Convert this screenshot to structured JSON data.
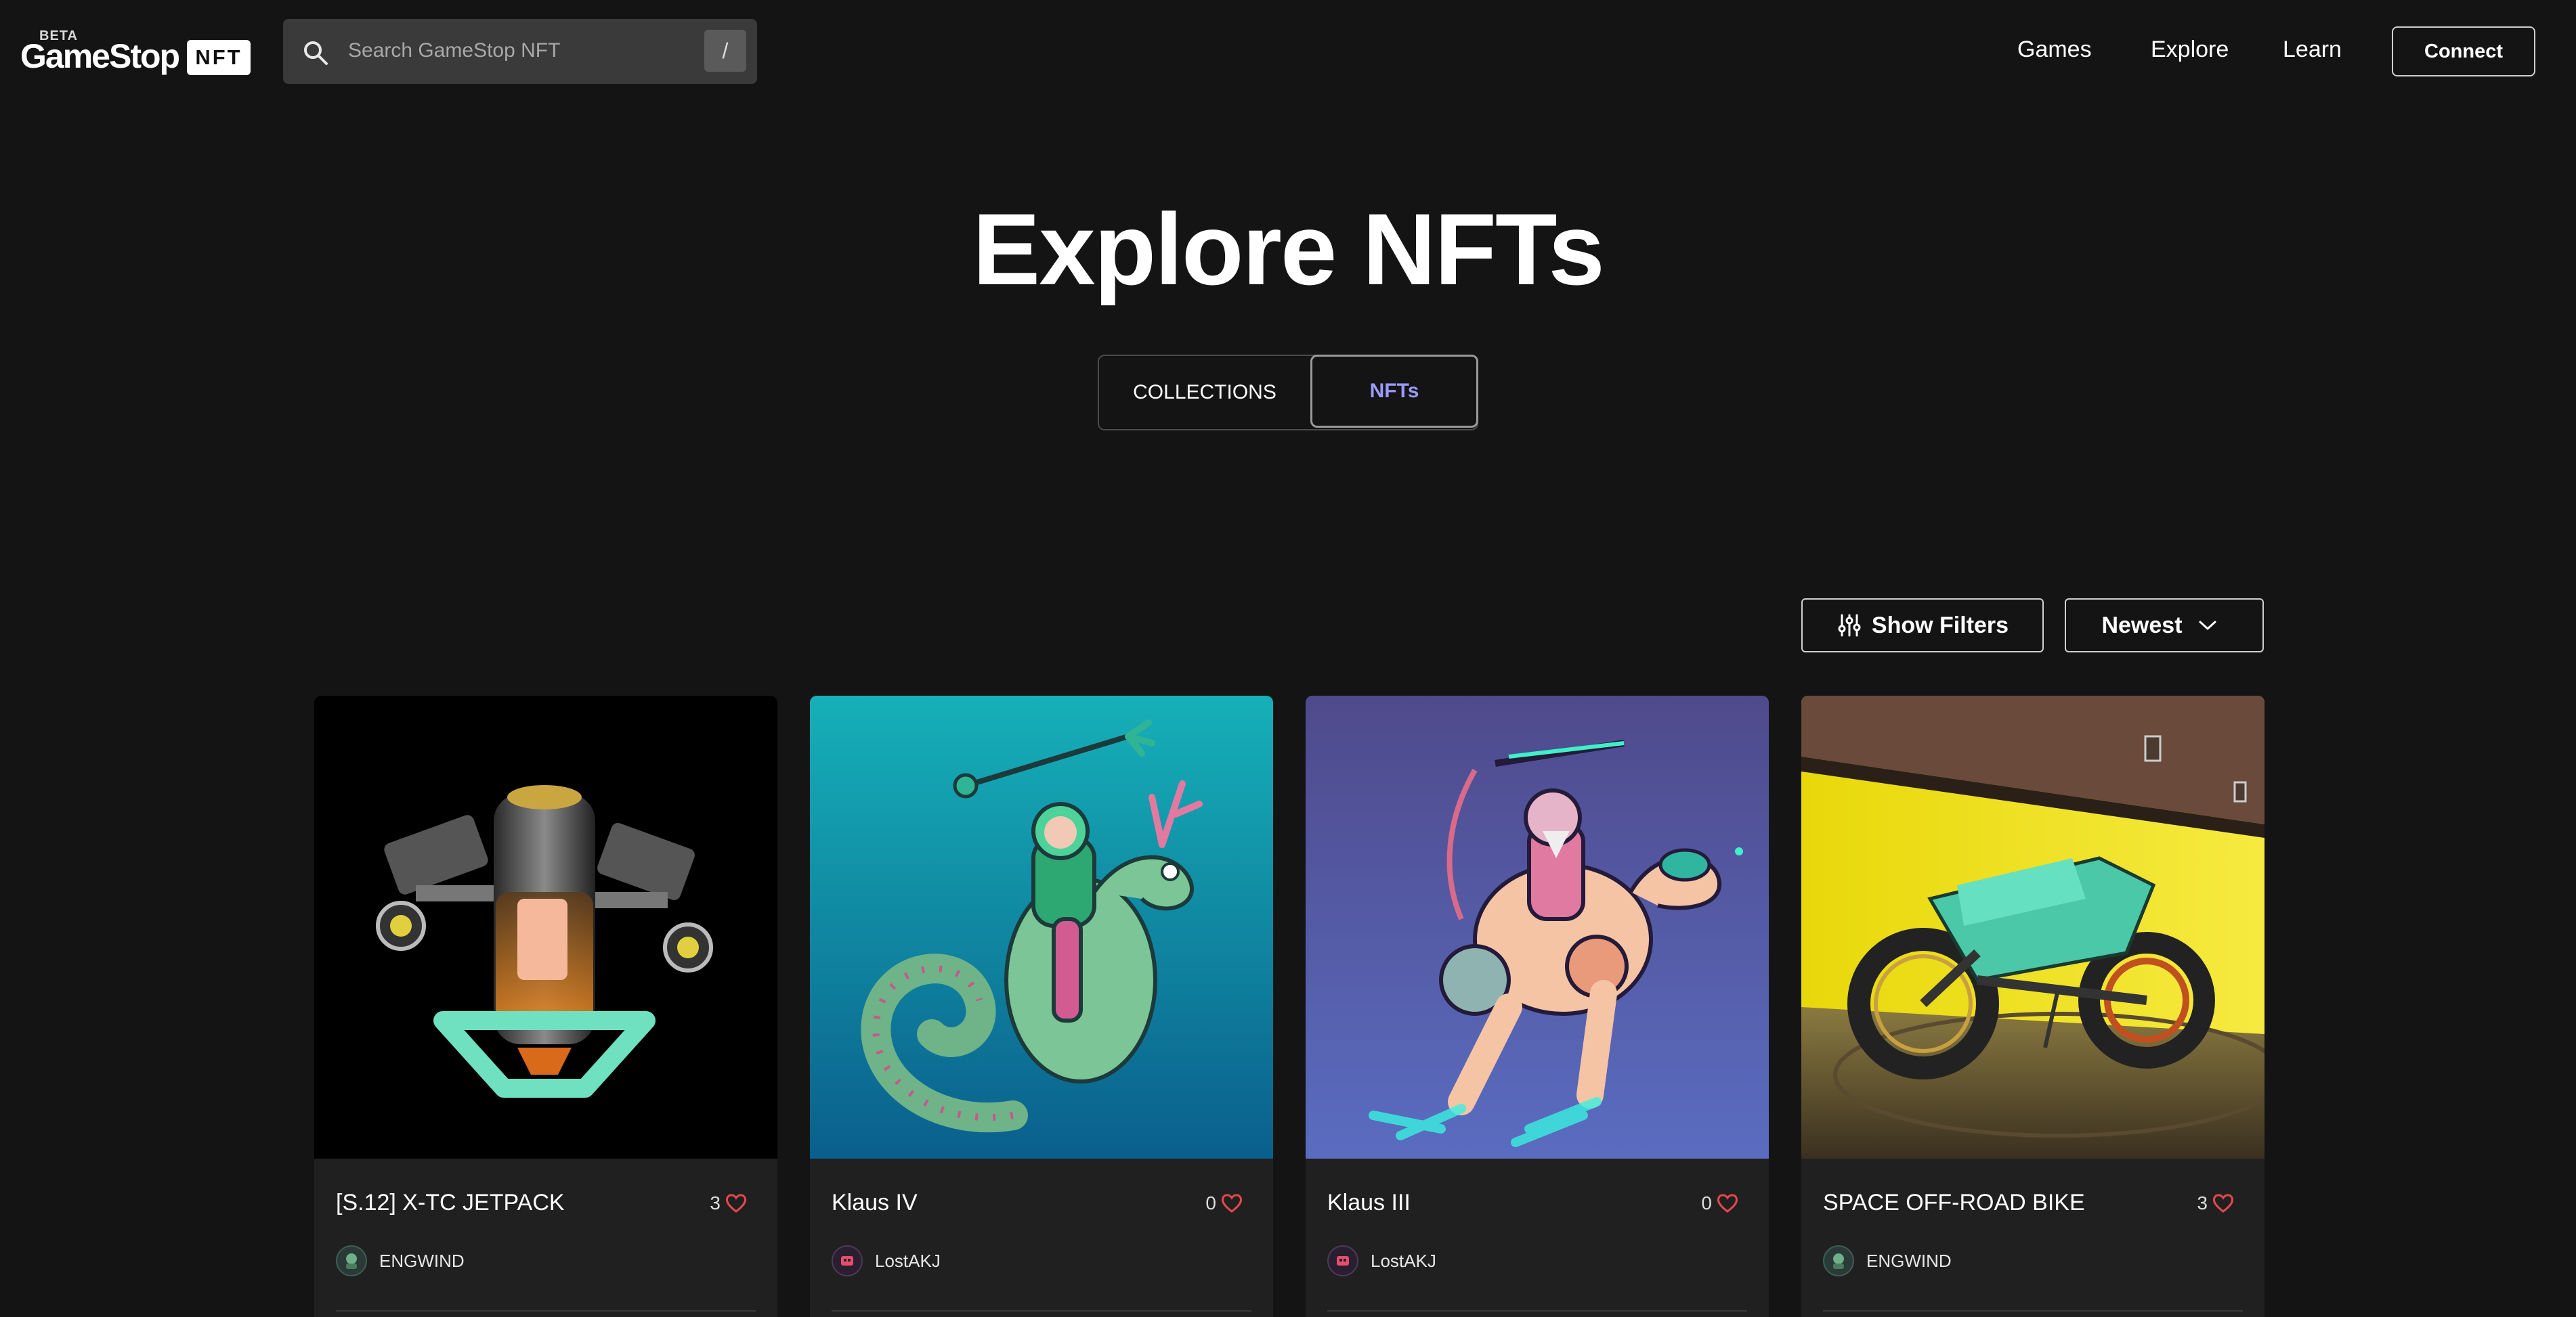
{
  "header": {
    "logo_beta": "BETA",
    "logo_text": "GameStop",
    "logo_badge": "NFT",
    "search_placeholder": "Search GameStop NFT",
    "search_shortcut": "/",
    "nav": [
      "Games",
      "Explore",
      "Learn"
    ],
    "connect_label": "Connect"
  },
  "hero": {
    "title": "Explore NFTs",
    "tabs": [
      "COLLECTIONS",
      "NFTs"
    ],
    "active_tab": "NFTs"
  },
  "toolbar": {
    "filters_label": "Show Filters",
    "sort_label": "Newest"
  },
  "cards": [
    {
      "name": "[S.12] X-TC JETPACK",
      "likes": "3",
      "creator": "ENGWIND",
      "image": "jetpack"
    },
    {
      "name": "Klaus IV",
      "likes": "0",
      "creator": "LostAKJ",
      "image": "seahorse-rider"
    },
    {
      "name": "Klaus III",
      "likes": "0",
      "creator": "LostAKJ",
      "image": "raptor-rider"
    },
    {
      "name": "SPACE OFF-ROAD BIKE",
      "likes": "3",
      "creator": "ENGWIND",
      "image": "space-bike"
    }
  ],
  "colors": {
    "background": "#141414",
    "card": "#202020",
    "heart": "#e5484d",
    "active_tab": "#9b9bff"
  }
}
